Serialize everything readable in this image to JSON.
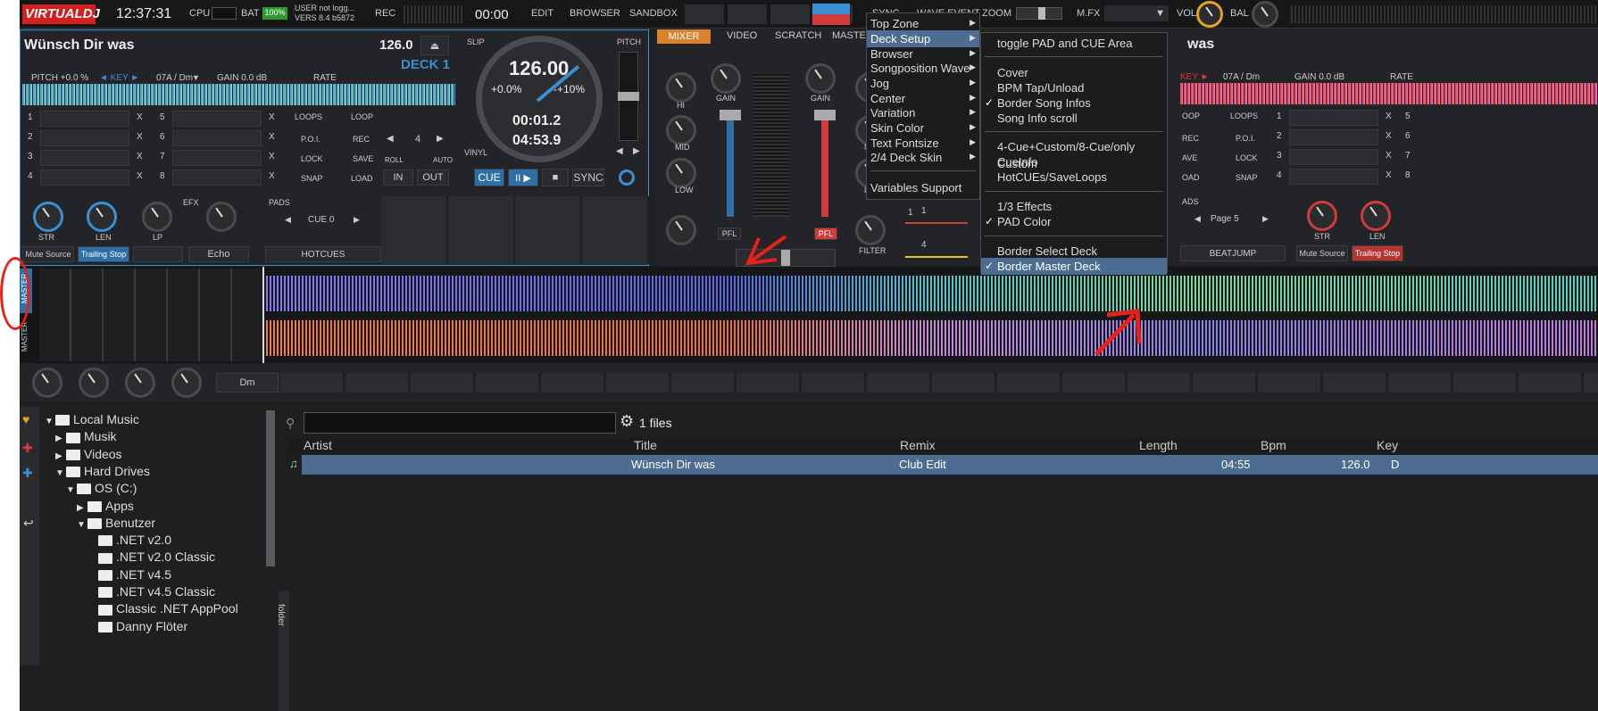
{
  "topbar": {
    "logo": "VIRTUALDJ",
    "time": "12:37:31",
    "cpu": "CPU",
    "bat": "BAT",
    "bat_val": "100%",
    "user_line1": "USER  not logg...",
    "user_line2": "VERS  8.4 b5872",
    "rec": "REC",
    "rec_time": "00:00",
    "edit": "EDIT",
    "browser": "BROWSER",
    "sandbox": "SANDBOX",
    "zoom": "ZOOM",
    "mfx": "M.FX",
    "vol": "VOL",
    "bal": "BAL",
    "hidden_tabs": "SYNC",
    "hidden_tabs2": "WAVE    EVENT"
  },
  "deck1": {
    "title": "Wünsch Dir was",
    "bpm": "126.0",
    "label": "DECK 1",
    "pitch": "PITCH +0.0 %",
    "key_label": "◄ KEY ►",
    "key": "07A / Dm",
    "gain": "GAIN 0.0 dB",
    "rate": "RATE",
    "slip": "SLIP",
    "pitch_label": "PITCH",
    "vinyl": "VINYL",
    "jog_bpm": "126.00",
    "jog_pitch_l": "+0.0%",
    "jog_pitch_r": "-+10%",
    "jog_elapsed": "00:01.2",
    "jog_remain": "04:53.9",
    "cue": "CUE",
    "play": "II ▶",
    "stop": "■",
    "sync": "SYNC",
    "cues_left": [
      "1",
      "2",
      "3",
      "4"
    ],
    "cues_right": [
      "5",
      "6",
      "7",
      "8"
    ],
    "x": "X",
    "loops": "LOOPS",
    "poi": "P.O.I.",
    "lock": "LOCK",
    "snap": "SNAP",
    "loop": "LOOP",
    "rec": "REC",
    "save": "SAVE",
    "load": "LOAD",
    "loop_size": "4",
    "roll": "ROLL",
    "auto": "AUTO",
    "in": "IN",
    "out": "OUT",
    "efx": "EFX",
    "str": "STR",
    "len": "LEN",
    "lp": "LP",
    "mute": "Mute Source",
    "trailing": "Trailing Stop",
    "echo": "Echo",
    "pads": "PADS",
    "cue0": "CUE 0",
    "hotcues": "HOTCUES"
  },
  "mixer": {
    "tabs": [
      "MIXER",
      "VIDEO",
      "SCRATCH",
      "MASTER"
    ],
    "gain": "GAIN",
    "hi": "HI",
    "mid": "MID",
    "low": "LOW",
    "filter": "FILTER",
    "pfl": "PFL",
    "loop1": "1",
    "loop4": "4"
  },
  "deck2": {
    "title": "was",
    "key": "07A / Dm",
    "key_label": "KEY ►",
    "gain": "GAIN 0.0 dB",
    "rate": "RATE",
    "loops": "LOOPS",
    "poi": "P.O.I.",
    "lock": "LOCK",
    "snap": "SNAP",
    "rec": "REC",
    "save": "AVE",
    "load": "OAD",
    "loop_hdr": "OOP",
    "pads": "ADS",
    "page": "Page 5",
    "beatjump": "BEATJUMP",
    "str": "STR",
    "len": "LEN",
    "mute": "Mute Source",
    "trailing": "Trailing Stop",
    "cues": [
      "1",
      "2",
      "3",
      "4"
    ],
    "cues_r": [
      "5",
      "6",
      "7",
      "8"
    ],
    "x": "X"
  },
  "waveform": {
    "master_top": "MASTER",
    "master_bottom": "MASTER",
    "key_cell": "Dm"
  },
  "menu1": {
    "items": [
      "Top Zone",
      "Deck Setup",
      "Browser",
      "Songposition Wave",
      "Jog",
      "Center",
      "Variation",
      "Skin Color",
      "Text Fontsize",
      "2/4 Deck Skin",
      "Variables Support"
    ],
    "selected": "Deck Setup"
  },
  "menu2": {
    "items": [
      "toggle PAD and CUE Area",
      "Cover",
      "BPM Tap/Unload",
      "Border Song Infos",
      "Song Info scroll",
      "4-Cue+Custom/8-Cue/only Custom",
      "CueInfo",
      "HotCUEs/SaveLoops",
      "1/3 Effects",
      "PAD Color",
      "Border Select Deck",
      "Border Master Deck"
    ],
    "checked": [
      "Border Song Infos",
      "PAD Color",
      "Border Master Deck"
    ],
    "selected": "Border Master Deck"
  },
  "browser": {
    "tree": [
      {
        "label": "Local Music",
        "indent": 0,
        "arrow": "▼"
      },
      {
        "label": "Musik",
        "indent": 1,
        "arrow": "▶"
      },
      {
        "label": "Videos",
        "indent": 1,
        "arrow": "▶"
      },
      {
        "label": "Hard Drives",
        "indent": 1,
        "arrow": "▼"
      },
      {
        "label": "OS (C:)",
        "indent": 2,
        "arrow": "▼"
      },
      {
        "label": "Apps",
        "indent": 3,
        "arrow": "▶"
      },
      {
        "label": "Benutzer",
        "indent": 3,
        "arrow": "▼"
      },
      {
        "label": ".NET v2.0",
        "indent": 4,
        "arrow": ""
      },
      {
        "label": ".NET v2.0 Classic",
        "indent": 4,
        "arrow": ""
      },
      {
        "label": ".NET v4.5",
        "indent": 4,
        "arrow": ""
      },
      {
        "label": ".NET v4.5 Classic",
        "indent": 4,
        "arrow": ""
      },
      {
        "label": "Classic .NET AppPool",
        "indent": 4,
        "arrow": ""
      },
      {
        "label": "Danny Flöter",
        "indent": 4,
        "arrow": ""
      }
    ],
    "search_placeholder": "",
    "files_count": "1 files",
    "columns": [
      "Artist",
      "Title",
      "Remix",
      "Length",
      "Bpm",
      "Key"
    ],
    "rows": [
      {
        "artist": "",
        "title": "Wünsch Dir was",
        "remix": "Club Edit",
        "length": "04:55",
        "bpm": "126.0",
        "key": "D"
      }
    ],
    "folder_tab": "folder"
  },
  "colors": {
    "accent": "#3a8fd3",
    "mixer_tab": "#d9822b",
    "red": "#d23b3b",
    "selection": "#4c6c91",
    "annotation": "#e8201c"
  }
}
